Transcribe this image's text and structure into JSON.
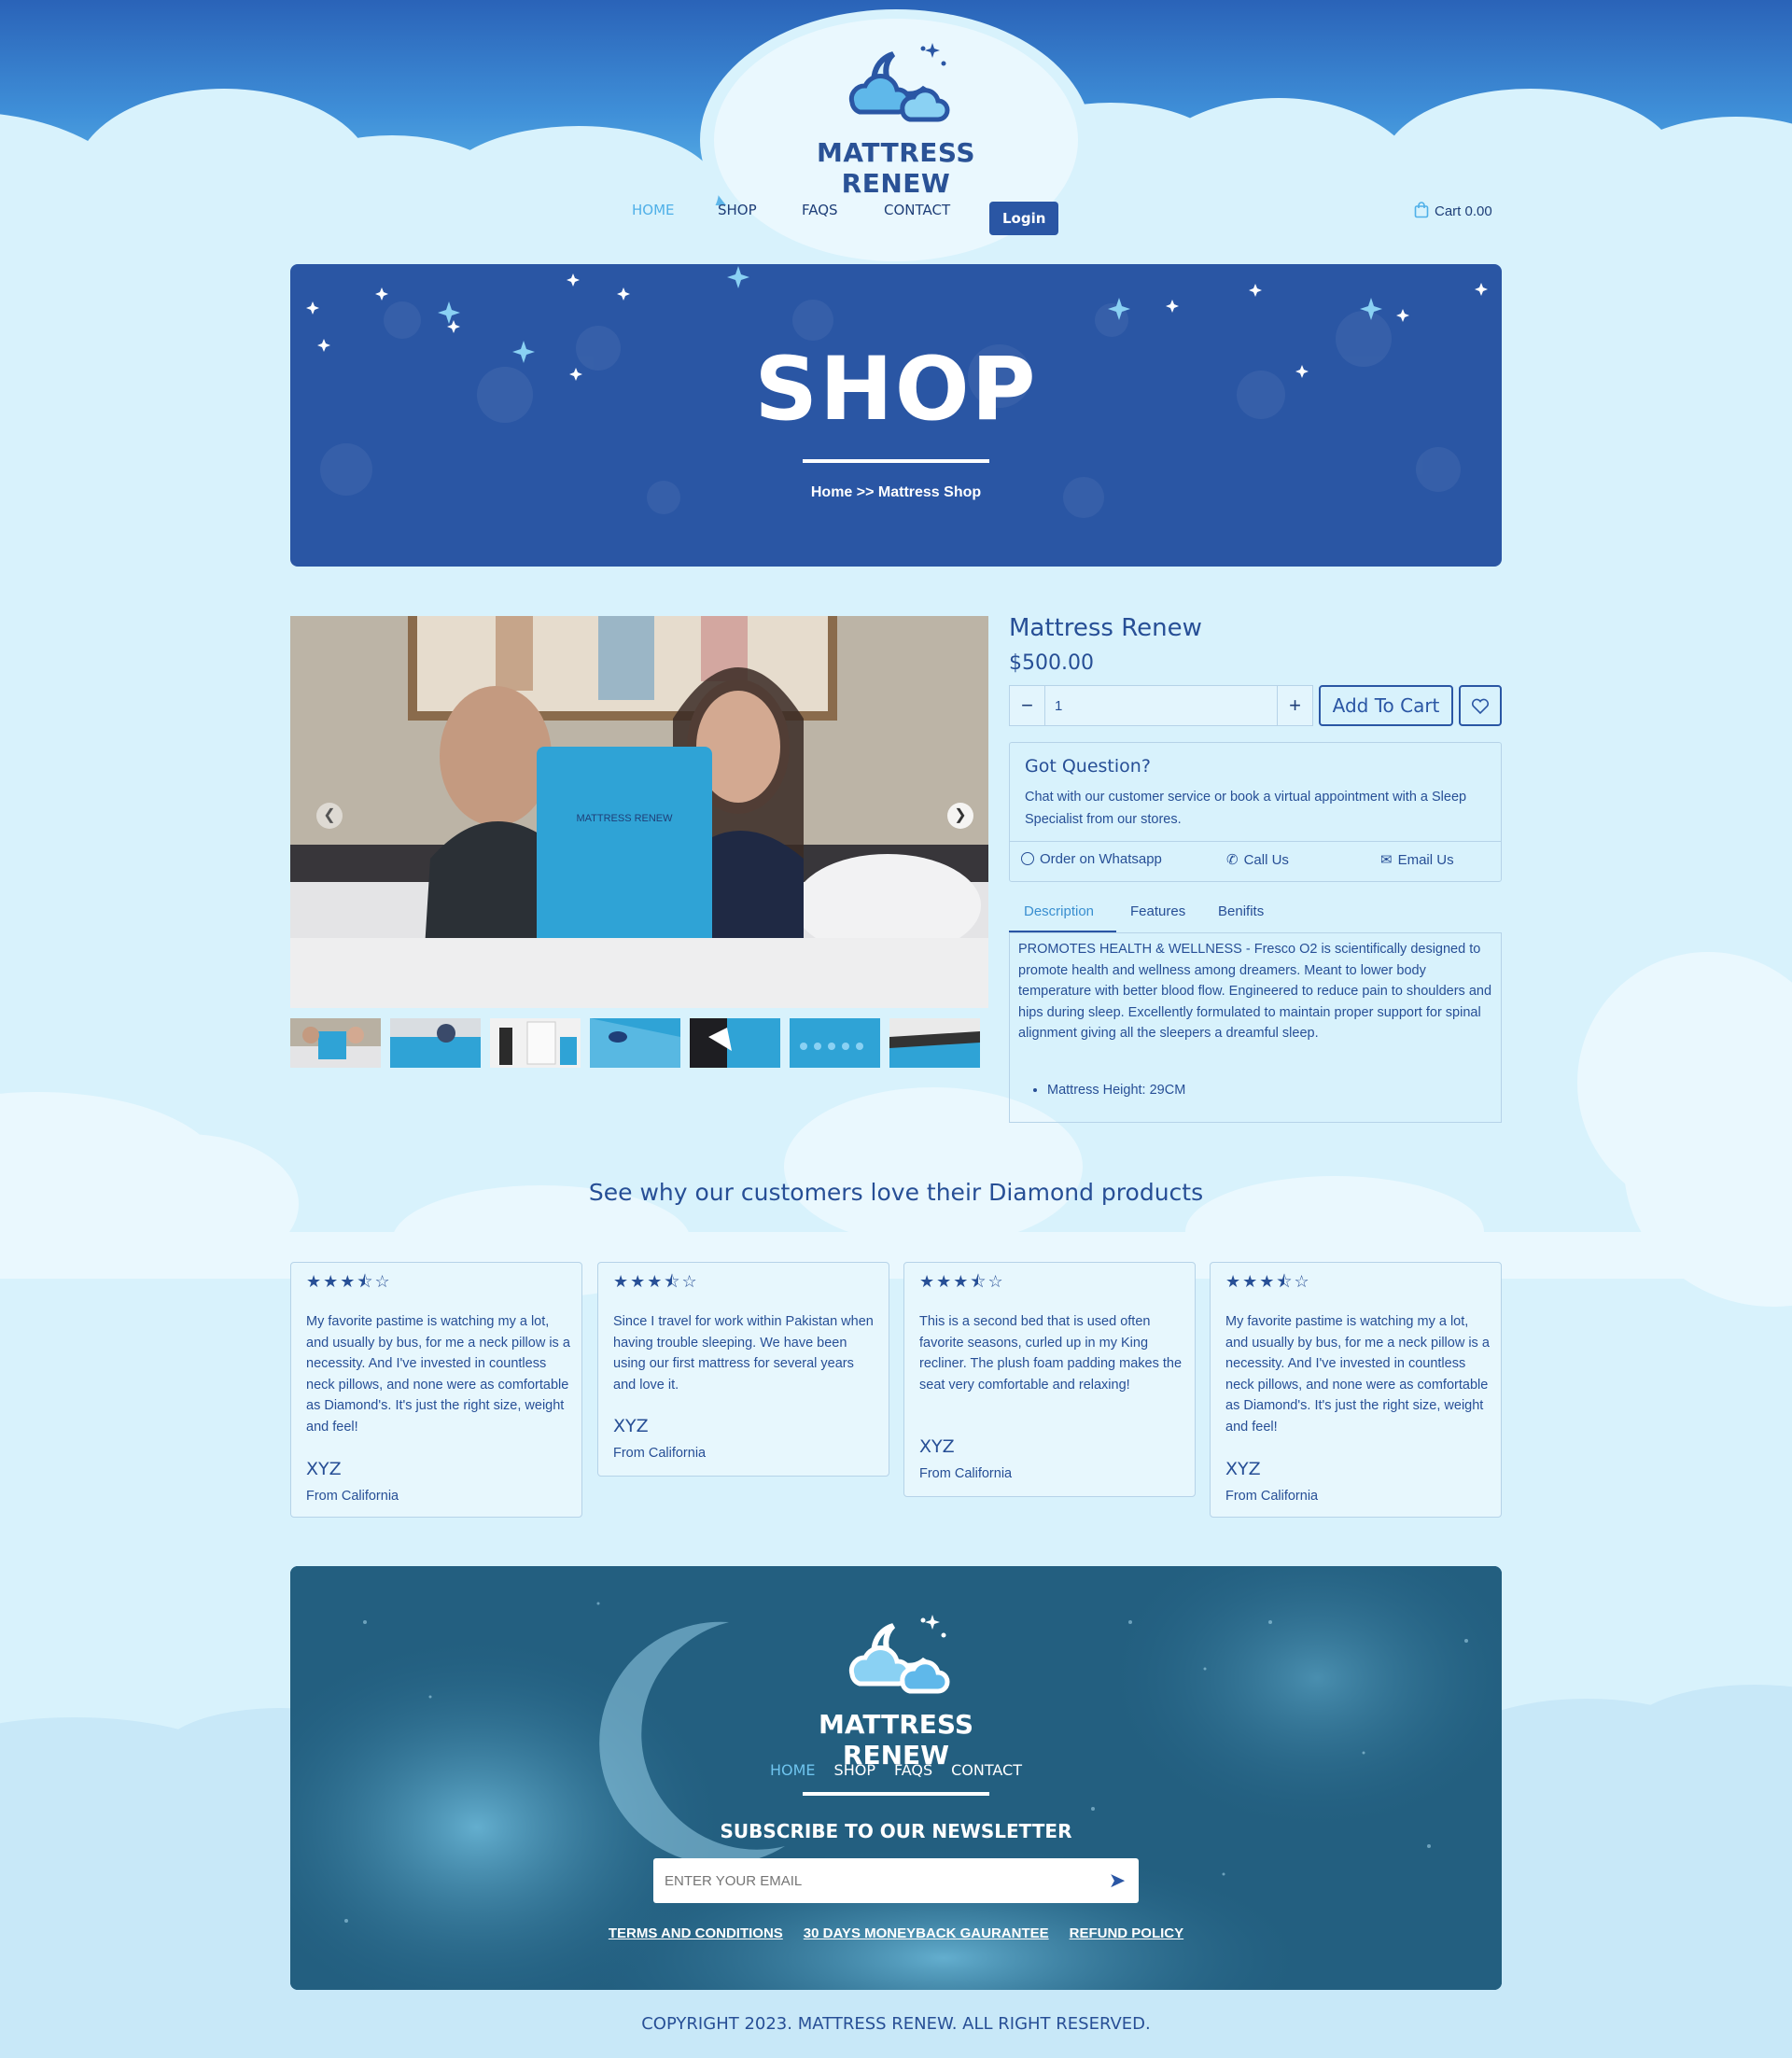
{
  "brand": {
    "name": "MATTRESS RENEW"
  },
  "nav": {
    "items": [
      {
        "label": "HOME",
        "active": true
      },
      {
        "label": "SHOP",
        "active": false
      },
      {
        "label": "FAQS",
        "active": false
      },
      {
        "label": "CONTACT",
        "active": false
      }
    ],
    "login_label": "Login",
    "cart_label": "Cart 0.00"
  },
  "banner": {
    "title": "SHOP",
    "breadcrumb": "Home  >>  Mattress Shop"
  },
  "gallery": {
    "prev_icon": "chevron-left-icon",
    "next_icon": "chevron-right-icon",
    "thumbnail_count": 7
  },
  "product": {
    "title": "Mattress Renew",
    "price": "$500.00",
    "quantity": "1",
    "add_to_cart_label": "Add To Cart",
    "question": {
      "title": "Got Question?",
      "text": "Chat with our customer service or book a virtual appointment with a Sleep Specialist from our stores.",
      "actions": [
        "Order on Whatsapp",
        "Call Us",
        "Email Us"
      ]
    },
    "tabs": [
      "Description",
      "Features",
      "Benifits"
    ],
    "description": "PROMOTES HEALTH & WELLNESS - Fresco O2 is scientifically designed to promote health and wellness among dreamers. Meant to lower body temperature with better blood flow. Engineered to reduce pain to shoulders and hips during sleep. Excellently formulated to maintain proper support for spinal alignment giving all the sleepers a dreamful sleep.",
    "bullet": "Mattress Height: 29CM"
  },
  "reviews": {
    "heading": "See why our customers love their Diamond products",
    "items": [
      {
        "rating": 3.5,
        "text": "My favorite pastime is watching my a lot, and usually by bus, for me a neck pillow is a necessity. And I've invested in countless neck pillows, and none were as comfortable as Diamond's. It's just the right size, weight and feel!",
        "name": "XYZ",
        "from": "From California"
      },
      {
        "rating": 3.5,
        "text": "Since I travel for work within Pakistan when having trouble sleeping. We have been using our first mattress for several years and love it.",
        "name": "XYZ",
        "from": "From California"
      },
      {
        "rating": 3.5,
        "text": "This is a second bed that is used often favorite seasons, curled up in my King recliner. The plush foam padding makes the seat very comfortable and relaxing!",
        "name": "XYZ",
        "from": "From California"
      },
      {
        "rating": 3.5,
        "text": "My favorite pastime is watching my a lot, and usually by bus, for me a neck pillow is a necessity. And I've invested in countless neck pillows, and none were as comfortable as Diamond's. It's just the right size, weight and feel!",
        "name": "XYZ",
        "from": "From California"
      }
    ]
  },
  "footer": {
    "nav": [
      "HOME",
      "SHOP",
      "FAQS",
      "CONTACT"
    ],
    "subscribe_title": "SUBSCRIBE TO OUR NEWSLETTER",
    "email_placeholder": "ENTER YOUR EMAIL",
    "links": [
      "TERMS AND CONDITIONS",
      "30 DAYS MONEYBACK GAURANTEE",
      "REFUND POLICY"
    ],
    "copyright": "COPYRIGHT 2023. MATTRESS RENEW. ALL RIGHT RESERVED."
  },
  "colors": {
    "brand_blue": "#2a56a4",
    "accent_light_blue": "#4fb0e8",
    "page_bg": "#d8f2fc",
    "footer_bg": "#2a6e90"
  }
}
